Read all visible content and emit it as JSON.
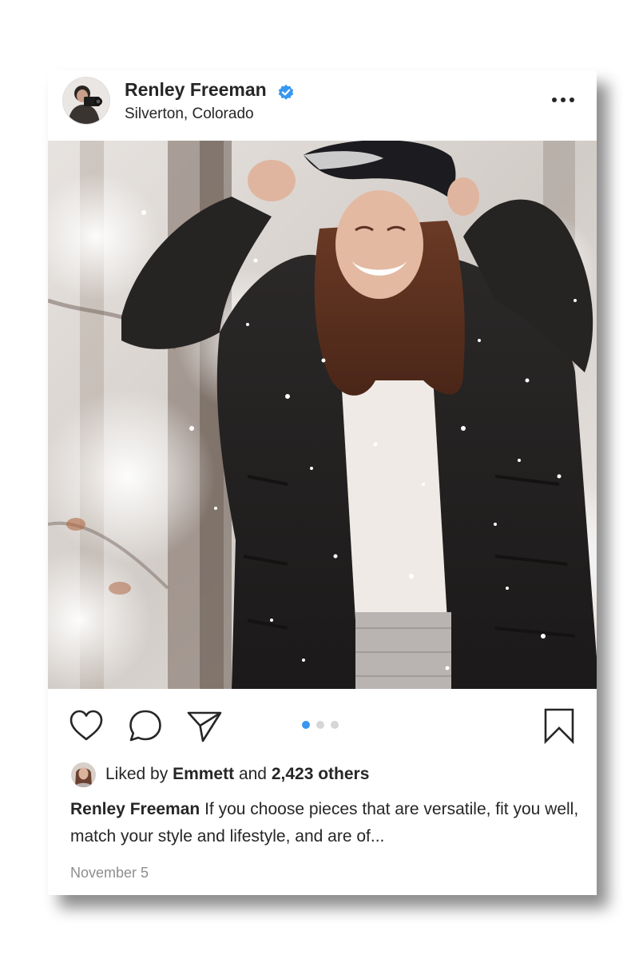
{
  "post": {
    "author": "Renley Freeman",
    "verified": true,
    "location": "Silverton, Colorado",
    "more_icon": "ellipsis-horizontal-icon",
    "carousel": {
      "count": 3,
      "current": 1
    },
    "likes": {
      "prefix": "Liked by",
      "user": "Emmett",
      "and": "and",
      "count_label": "2,423 others"
    },
    "caption": {
      "author": "Renley Freeman",
      "text": "If you choose pieces that are versatile, fit you well, match your style and lifestyle, and are of..."
    },
    "date": "November 5"
  },
  "colors": {
    "verified_badge": "#3897f0",
    "carousel_active": "#3897f0",
    "carousel_inactive": "#d6d6d6",
    "date_text": "#8e8e8e"
  },
  "icons": {
    "like": "heart-icon",
    "comment": "comment-bubble-icon",
    "share": "paper-plane-icon",
    "save": "bookmark-icon"
  }
}
